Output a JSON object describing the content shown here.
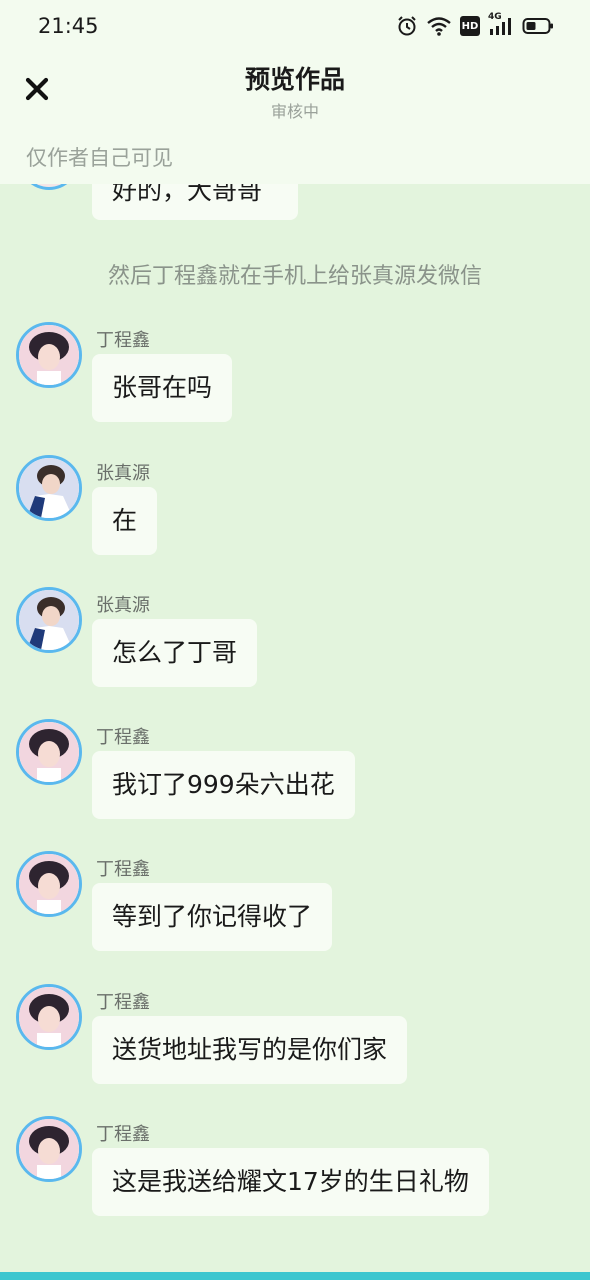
{
  "status_bar": {
    "time": "21:45",
    "icons": [
      "alarm-icon",
      "wifi-icon",
      "hd-icon",
      "signal-4g-icon",
      "battery-icon"
    ],
    "hd_label": "HD",
    "network_label": "4G"
  },
  "header": {
    "title": "预览作品",
    "subtitle": "审核中",
    "visibility_note": "仅作者自己可见"
  },
  "chat": {
    "partial_message": "好的，大哥哥",
    "narration": "然后丁程鑫就在手机上给张真源发微信",
    "messages": [
      {
        "sender": "丁程鑫",
        "text": "张哥在吗"
      },
      {
        "sender": "张真源",
        "text": "在"
      },
      {
        "sender": "张真源",
        "text": "怎么了丁哥"
      },
      {
        "sender": "丁程鑫",
        "text": "我订了999朵六出花"
      },
      {
        "sender": "丁程鑫",
        "text": "等到了你记得收了"
      },
      {
        "sender": "丁程鑫",
        "text": "送货地址我写的是你们家"
      },
      {
        "sender": "丁程鑫",
        "text": "这是我送给耀文17岁的生日礼物"
      }
    ]
  },
  "colors": {
    "background": "#e3f4dd",
    "header_bg": "#f3fbef",
    "bubble_bg": "#f7fcf4",
    "avatar_ring": "#5ab8ee",
    "bottom_accent": "#3cc6cf"
  }
}
